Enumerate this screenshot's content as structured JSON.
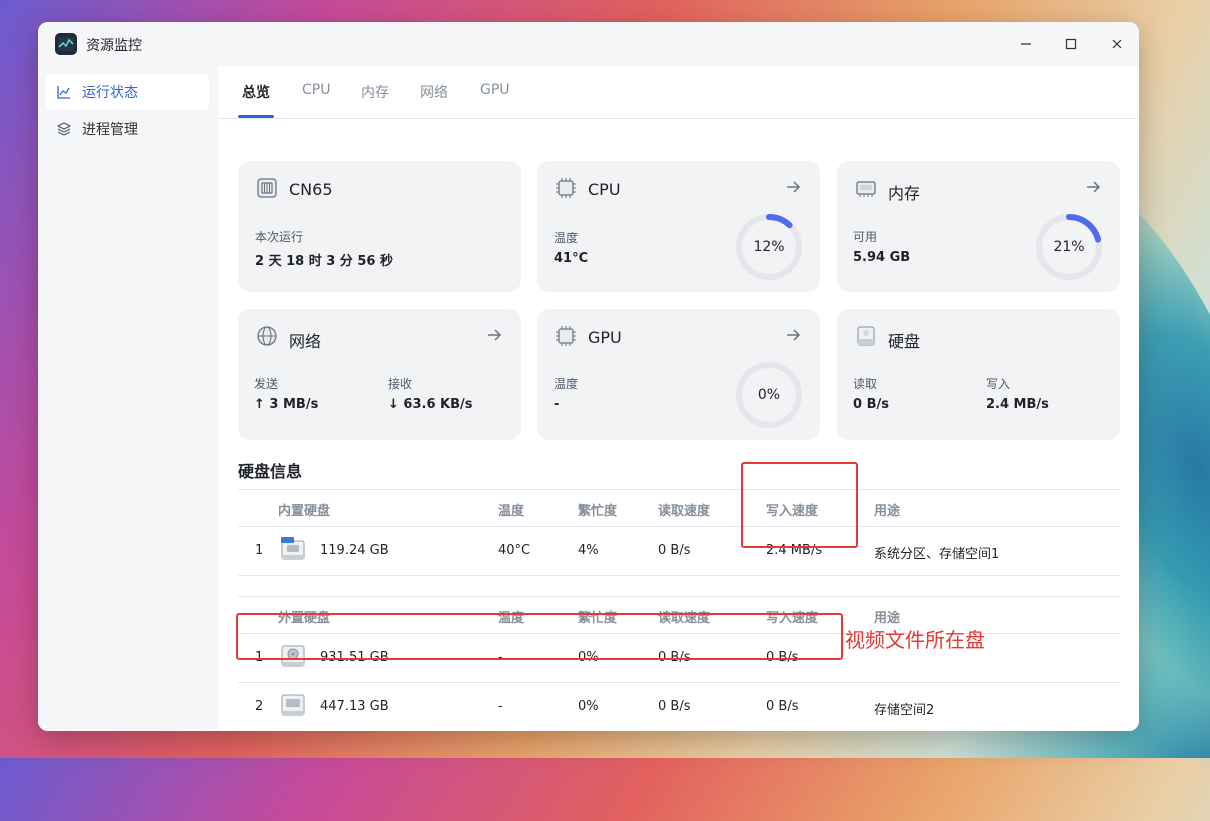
{
  "window": {
    "title": "资源监控"
  },
  "sidebar": {
    "items": [
      {
        "label": "运行状态",
        "active": true
      },
      {
        "label": "进程管理",
        "active": false
      }
    ]
  },
  "tabs": [
    "总览",
    "CPU",
    "内存",
    "网络",
    "GPU"
  ],
  "cards": {
    "system": {
      "title": "CN65",
      "uptime_label": "本次运行",
      "uptime_value": "2 天 18 时 3 分 56 秒"
    },
    "cpu": {
      "title": "CPU",
      "temp_label": "温度",
      "temp_value": "41°C",
      "usage": "12%",
      "usage_fraction": 0.12
    },
    "memory": {
      "title": "内存",
      "avail_label": "可用",
      "avail_value": "5.94 GB",
      "usage": "21%",
      "usage_fraction": 0.21
    },
    "network": {
      "title": "网络",
      "send_label": "发送",
      "send_value": "↑ 3 MB/s",
      "recv_label": "接收",
      "recv_value": "↓ 63.6 KB/s"
    },
    "gpu": {
      "title": "GPU",
      "temp_label": "温度",
      "temp_value": "-",
      "usage": "0%",
      "usage_fraction": 0
    },
    "disk": {
      "title": "硬盘",
      "read_label": "读取",
      "read_value": "0 B/s",
      "write_label": "写入",
      "write_value": "2.4 MB/s"
    }
  },
  "disk_info": {
    "title": "硬盘信息",
    "internal": {
      "headers": [
        "内置硬盘",
        "温度",
        "繁忙度",
        "读取速度",
        "写入速度",
        "用途"
      ],
      "rows": [
        {
          "index": "1",
          "capacity": "119.24 GB",
          "temp": "40°C",
          "busy": "4%",
          "read": "0 B/s",
          "write": "2.4 MB/s",
          "usage": "系统分区、存储空间1"
        }
      ]
    },
    "external": {
      "headers": [
        "外置硬盘",
        "温度",
        "繁忙度",
        "读取速度",
        "写入速度",
        "用途"
      ],
      "rows": [
        {
          "index": "1",
          "capacity": "931.51 GB",
          "temp": "-",
          "busy": "0%",
          "read": "0 B/s",
          "write": "0 B/s",
          "usage": ""
        },
        {
          "index": "2",
          "capacity": "447.13 GB",
          "temp": "-",
          "busy": "0%",
          "read": "0 B/s",
          "write": "0 B/s",
          "usage": "存储空间2"
        }
      ]
    }
  },
  "annotation": {
    "text": "视频文件所在盘"
  },
  "colors": {
    "accent": "#3264d6",
    "gauge_fill": "#4f6cf0",
    "gauge_track": "#e5e6eb",
    "annotation_red": "#e53935"
  }
}
